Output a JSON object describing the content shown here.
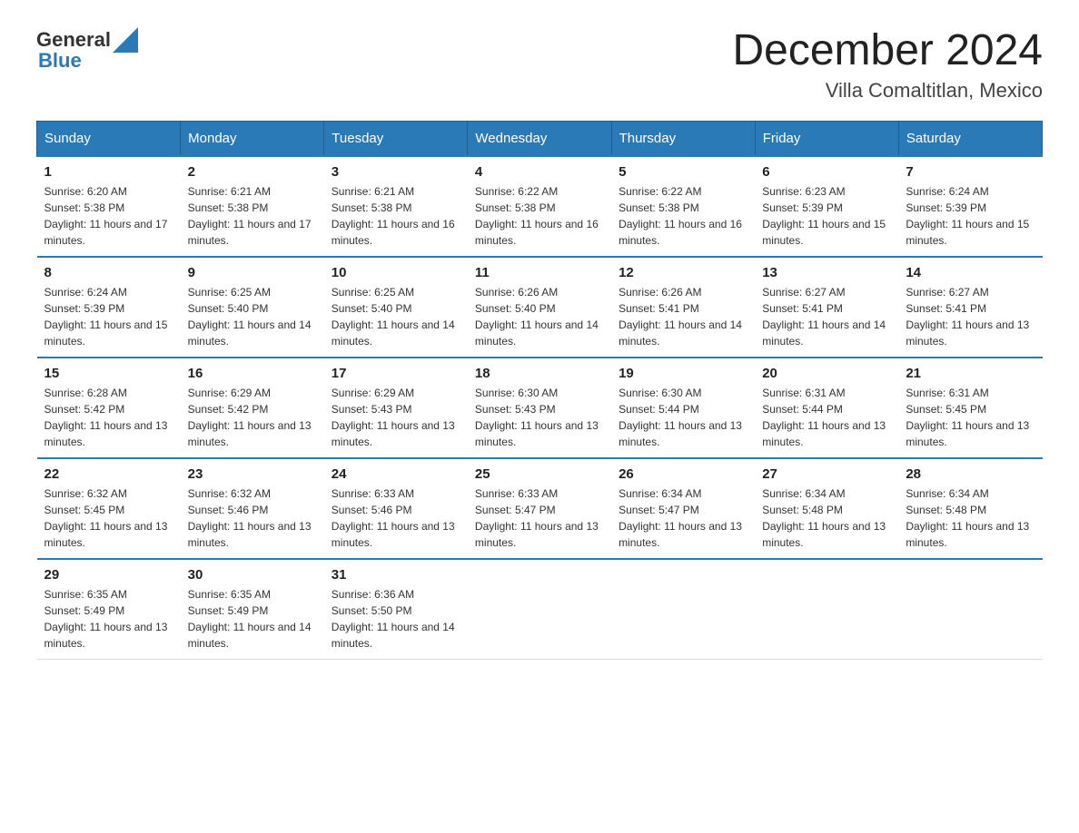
{
  "header": {
    "logo_general": "General",
    "logo_blue": "Blue",
    "month_year": "December 2024",
    "location": "Villa Comaltitlan, Mexico"
  },
  "weekdays": [
    "Sunday",
    "Monday",
    "Tuesday",
    "Wednesday",
    "Thursday",
    "Friday",
    "Saturday"
  ],
  "weeks": [
    [
      {
        "day": "1",
        "sunrise": "6:20 AM",
        "sunset": "5:38 PM",
        "daylight": "11 hours and 17 minutes."
      },
      {
        "day": "2",
        "sunrise": "6:21 AM",
        "sunset": "5:38 PM",
        "daylight": "11 hours and 17 minutes."
      },
      {
        "day": "3",
        "sunrise": "6:21 AM",
        "sunset": "5:38 PM",
        "daylight": "11 hours and 16 minutes."
      },
      {
        "day": "4",
        "sunrise": "6:22 AM",
        "sunset": "5:38 PM",
        "daylight": "11 hours and 16 minutes."
      },
      {
        "day": "5",
        "sunrise": "6:22 AM",
        "sunset": "5:38 PM",
        "daylight": "11 hours and 16 minutes."
      },
      {
        "day": "6",
        "sunrise": "6:23 AM",
        "sunset": "5:39 PM",
        "daylight": "11 hours and 15 minutes."
      },
      {
        "day": "7",
        "sunrise": "6:24 AM",
        "sunset": "5:39 PM",
        "daylight": "11 hours and 15 minutes."
      }
    ],
    [
      {
        "day": "8",
        "sunrise": "6:24 AM",
        "sunset": "5:39 PM",
        "daylight": "11 hours and 15 minutes."
      },
      {
        "day": "9",
        "sunrise": "6:25 AM",
        "sunset": "5:40 PM",
        "daylight": "11 hours and 14 minutes."
      },
      {
        "day": "10",
        "sunrise": "6:25 AM",
        "sunset": "5:40 PM",
        "daylight": "11 hours and 14 minutes."
      },
      {
        "day": "11",
        "sunrise": "6:26 AM",
        "sunset": "5:40 PM",
        "daylight": "11 hours and 14 minutes."
      },
      {
        "day": "12",
        "sunrise": "6:26 AM",
        "sunset": "5:41 PM",
        "daylight": "11 hours and 14 minutes."
      },
      {
        "day": "13",
        "sunrise": "6:27 AM",
        "sunset": "5:41 PM",
        "daylight": "11 hours and 14 minutes."
      },
      {
        "day": "14",
        "sunrise": "6:27 AM",
        "sunset": "5:41 PM",
        "daylight": "11 hours and 13 minutes."
      }
    ],
    [
      {
        "day": "15",
        "sunrise": "6:28 AM",
        "sunset": "5:42 PM",
        "daylight": "11 hours and 13 minutes."
      },
      {
        "day": "16",
        "sunrise": "6:29 AM",
        "sunset": "5:42 PM",
        "daylight": "11 hours and 13 minutes."
      },
      {
        "day": "17",
        "sunrise": "6:29 AM",
        "sunset": "5:43 PM",
        "daylight": "11 hours and 13 minutes."
      },
      {
        "day": "18",
        "sunrise": "6:30 AM",
        "sunset": "5:43 PM",
        "daylight": "11 hours and 13 minutes."
      },
      {
        "day": "19",
        "sunrise": "6:30 AM",
        "sunset": "5:44 PM",
        "daylight": "11 hours and 13 minutes."
      },
      {
        "day": "20",
        "sunrise": "6:31 AM",
        "sunset": "5:44 PM",
        "daylight": "11 hours and 13 minutes."
      },
      {
        "day": "21",
        "sunrise": "6:31 AM",
        "sunset": "5:45 PM",
        "daylight": "11 hours and 13 minutes."
      }
    ],
    [
      {
        "day": "22",
        "sunrise": "6:32 AM",
        "sunset": "5:45 PM",
        "daylight": "11 hours and 13 minutes."
      },
      {
        "day": "23",
        "sunrise": "6:32 AM",
        "sunset": "5:46 PM",
        "daylight": "11 hours and 13 minutes."
      },
      {
        "day": "24",
        "sunrise": "6:33 AM",
        "sunset": "5:46 PM",
        "daylight": "11 hours and 13 minutes."
      },
      {
        "day": "25",
        "sunrise": "6:33 AM",
        "sunset": "5:47 PM",
        "daylight": "11 hours and 13 minutes."
      },
      {
        "day": "26",
        "sunrise": "6:34 AM",
        "sunset": "5:47 PM",
        "daylight": "11 hours and 13 minutes."
      },
      {
        "day": "27",
        "sunrise": "6:34 AM",
        "sunset": "5:48 PM",
        "daylight": "11 hours and 13 minutes."
      },
      {
        "day": "28",
        "sunrise": "6:34 AM",
        "sunset": "5:48 PM",
        "daylight": "11 hours and 13 minutes."
      }
    ],
    [
      {
        "day": "29",
        "sunrise": "6:35 AM",
        "sunset": "5:49 PM",
        "daylight": "11 hours and 13 minutes."
      },
      {
        "day": "30",
        "sunrise": "6:35 AM",
        "sunset": "5:49 PM",
        "daylight": "11 hours and 14 minutes."
      },
      {
        "day": "31",
        "sunrise": "6:36 AM",
        "sunset": "5:50 PM",
        "daylight": "11 hours and 14 minutes."
      },
      null,
      null,
      null,
      null
    ]
  ]
}
